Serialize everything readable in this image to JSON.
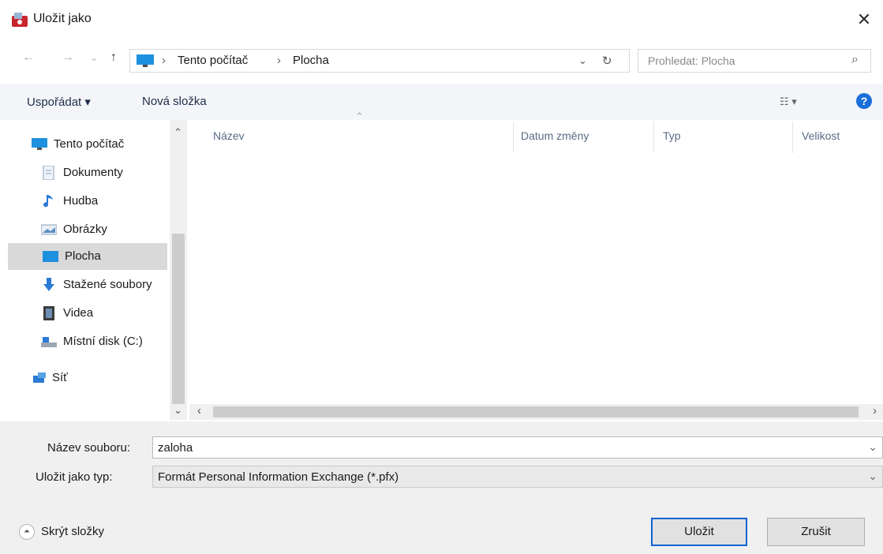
{
  "window": {
    "title": "Uložit jako",
    "close_glyph": "✕"
  },
  "nav": {
    "back_glyph": "←",
    "forward_glyph": "→",
    "recent_glyph": "⌄",
    "up_glyph": "↑"
  },
  "address": {
    "crumbs": [
      "Tento počítač",
      "Plocha"
    ],
    "separator": "›",
    "dropdown_glyph": "⌄",
    "refresh_glyph": "↻"
  },
  "search": {
    "placeholder": "Prohledat: Plocha",
    "icon_glyph": "⌕"
  },
  "toolbar": {
    "organize_label": "Uspořádat ▾",
    "new_folder_label": "Nová složka",
    "view_glyph": "☷ ▾",
    "help_glyph": "?"
  },
  "sidebar": {
    "scroll_up_glyph": "⌃",
    "scroll_down_glyph": "⌄",
    "items": [
      {
        "label": "Tento počítač",
        "icon": "computer-icon"
      },
      {
        "label": "Dokumenty",
        "icon": "documents-icon"
      },
      {
        "label": "Hudba",
        "icon": "music-icon"
      },
      {
        "label": "Obrázky",
        "icon": "pictures-icon"
      },
      {
        "label": "Plocha",
        "icon": "desktop-icon"
      },
      {
        "label": "Stažené soubory",
        "icon": "downloads-icon"
      },
      {
        "label": "Videa",
        "icon": "videos-icon"
      },
      {
        "label": "Místní disk (C:)",
        "icon": "local-disk-icon"
      },
      {
        "label": "Síť",
        "icon": "network-icon"
      }
    ]
  },
  "file_list": {
    "columns": [
      "Název",
      "Datum změny",
      "Typ",
      "Velikost"
    ],
    "sort_glyph": "⌃",
    "scroll_left_glyph": "‹",
    "scroll_right_glyph": "›"
  },
  "form": {
    "filename_label": "Název souboru:",
    "filename_value": "zaloha",
    "type_label": "Uložit jako typ:",
    "type_value": "Formát Personal Information Exchange (*.pfx)",
    "dropdown_glyph": "⌄"
  },
  "footer": {
    "hide_folders_label": "Skrýt složky",
    "hide_folders_glyph": "⏶",
    "save_label": "Uložit",
    "cancel_label": "Zrušit"
  },
  "colors": {
    "accent": "#0a64d1",
    "selected_bg": "#d9d9d9",
    "toolbar_bg": "#f3f5f9",
    "bottom_bg": "#f0f0f0"
  }
}
